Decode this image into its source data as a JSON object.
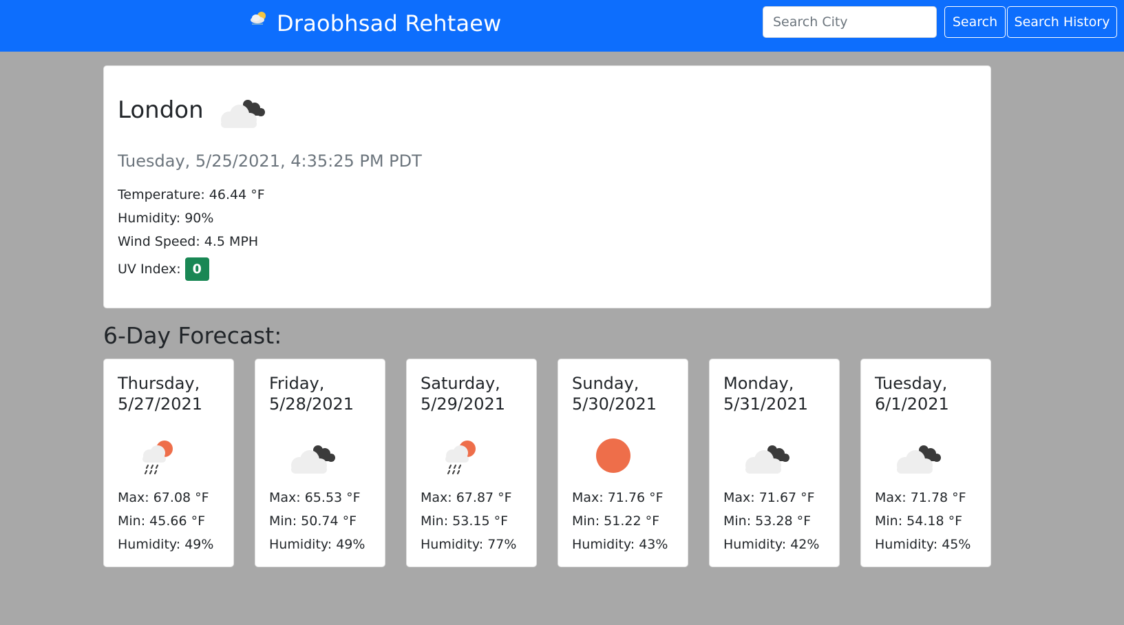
{
  "header": {
    "title": "Draobhsad Rehtaew",
    "logo_icon": "partly-cloudy-icon",
    "search_placeholder": "Search City",
    "search_label": "Search",
    "history_label": "Search History",
    "color": "#0d6efd"
  },
  "current": {
    "city": "London",
    "icon": "broken-clouds-icon",
    "datetime": "Tuesday, 5/25/2021, 4:35:25 PM PDT",
    "temperature": "Temperature: 46.44 °F",
    "humidity": "Humidity: 90%",
    "wind": "Wind Speed: 4.5 MPH",
    "uv_label": "UV Index:",
    "uv_value": "0",
    "uv_color": "#198754"
  },
  "forecast": {
    "heading": "6-Day Forecast:",
    "days": [
      {
        "day": "Thursday,",
        "date": "5/27/2021",
        "icon": "rain-sun-icon",
        "max": "Max: 67.08 °F",
        "min": "Min: 45.66 °F",
        "humidity": "Humidity: 49%"
      },
      {
        "day": "Friday,",
        "date": "5/28/2021",
        "icon": "broken-clouds-icon",
        "max": "Max: 65.53 °F",
        "min": "Min: 50.74 °F",
        "humidity": "Humidity: 49%"
      },
      {
        "day": "Saturday,",
        "date": "5/29/2021",
        "icon": "rain-sun-icon",
        "max": "Max: 67.87 °F",
        "min": "Min: 53.15 °F",
        "humidity": "Humidity: 77%"
      },
      {
        "day": "Sunday,",
        "date": "5/30/2021",
        "icon": "sun-icon",
        "max": "Max: 71.76 °F",
        "min": "Min: 51.22 °F",
        "humidity": "Humidity: 43%"
      },
      {
        "day": "Monday,",
        "date": "5/31/2021",
        "icon": "broken-clouds-icon",
        "max": "Max: 71.67 °F",
        "min": "Min: 53.28 °F",
        "humidity": "Humidity: 42%"
      },
      {
        "day": "Tuesday,",
        "date": "6/1/2021",
        "icon": "broken-clouds-icon",
        "max": "Max: 71.78 °F",
        "min": "Min: 54.18 °F",
        "humidity": "Humidity: 45%"
      }
    ]
  }
}
